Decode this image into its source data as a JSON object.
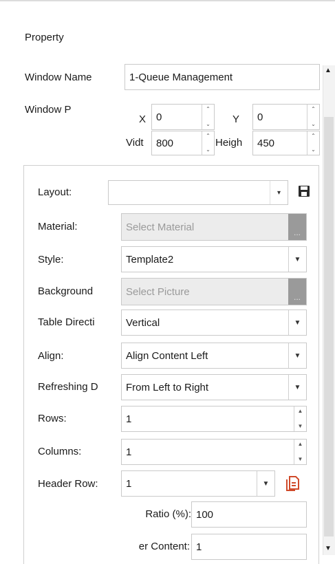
{
  "panel": {
    "title": "Property"
  },
  "window_name": {
    "label": "Window Name",
    "value": "1-Queue Management"
  },
  "window_pos": {
    "label": "Window P",
    "x_label": "X",
    "x_value": "0",
    "y_label": "Y",
    "y_value": "0",
    "w_label": "Vidt",
    "w_value": "800",
    "h_label": "Heigh",
    "h_value": "450"
  },
  "layout": {
    "label": "Layout:",
    "value": "",
    "save_icon": "save-icon"
  },
  "material": {
    "label": "Material:",
    "placeholder": "Select Material",
    "browse": "..."
  },
  "style": {
    "label": "Style:",
    "value": "Template2"
  },
  "background": {
    "label": "Background",
    "placeholder": "Select Picture",
    "browse": "..."
  },
  "table_direction": {
    "label": "Table Directi",
    "value": "Vertical"
  },
  "align": {
    "label": "Align:",
    "value": "Align Content Left"
  },
  "refreshing": {
    "label": "Refreshing D",
    "value": "From Left to Right"
  },
  "rows": {
    "label": "Rows:",
    "value": "1"
  },
  "columns": {
    "label": "Columns:",
    "value": "1"
  },
  "header_row": {
    "label": "Header Row:",
    "value": "1",
    "icon": "copy-document-icon"
  },
  "ratio": {
    "label": "Ratio (%):",
    "value": "100"
  },
  "header_content": {
    "label": "er Content:",
    "value": "1"
  },
  "glyphs": {
    "up": "▲",
    "down": "▼",
    "caret": "▾",
    "spin_up": "⌃",
    "spin_down": "⌄"
  },
  "colors": {
    "accent_red": "#d04a2a",
    "disabled_bg": "#ececec",
    "browse_bg": "#9a9a9a"
  }
}
